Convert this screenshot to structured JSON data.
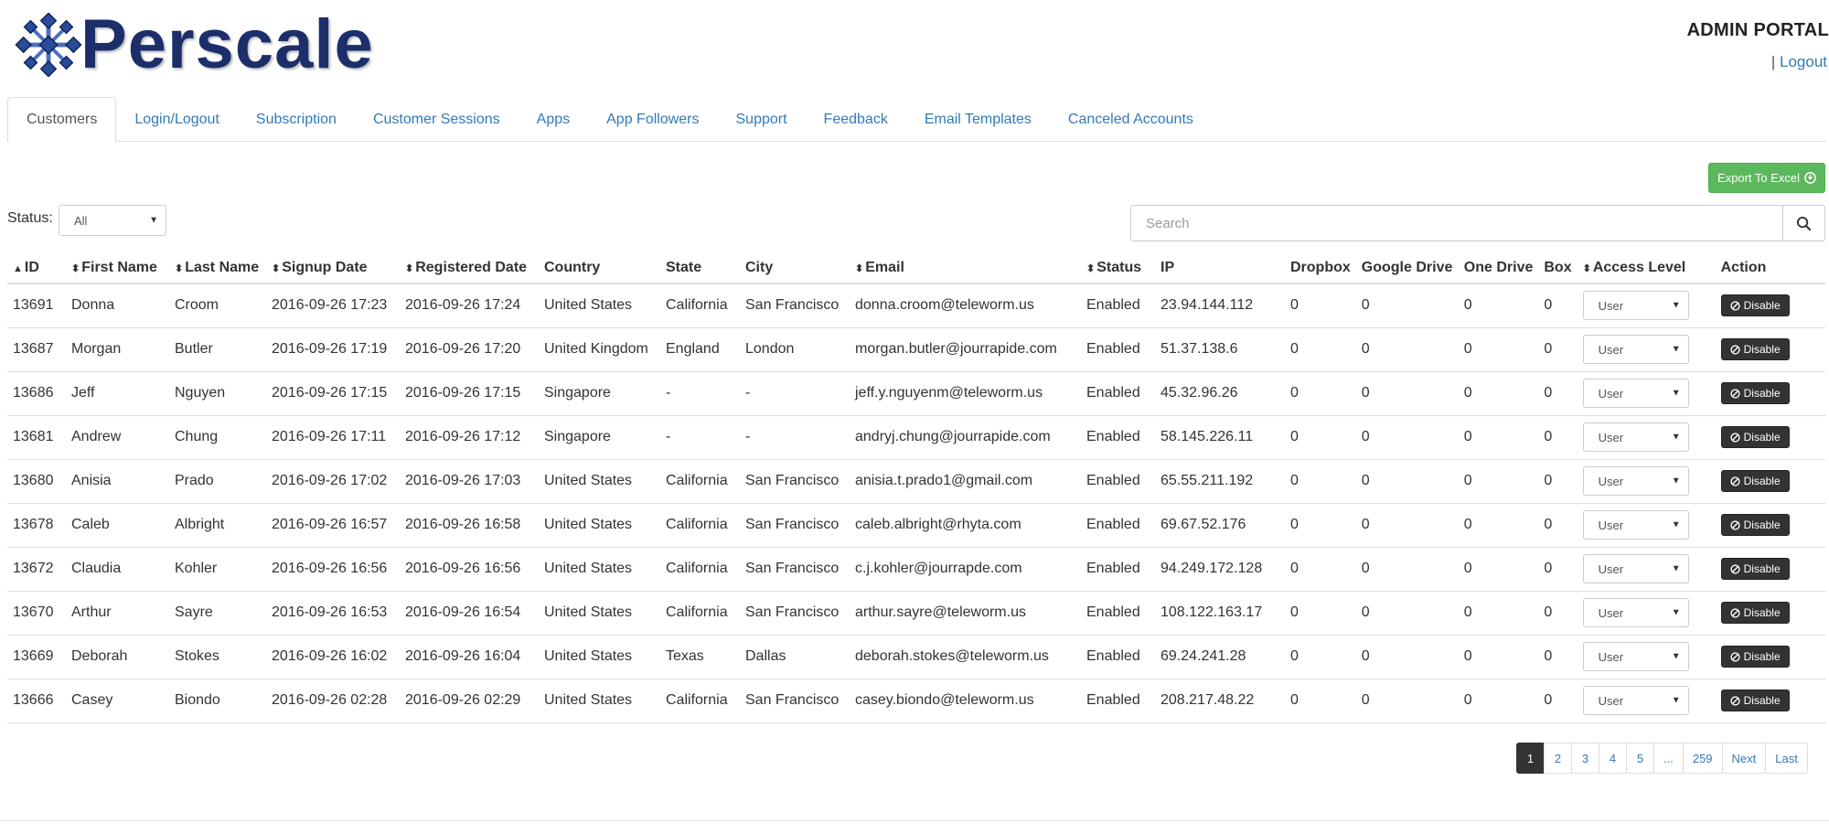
{
  "brand": {
    "name": "Perscale",
    "color": "#1c2f6b"
  },
  "header": {
    "portal_title": "ADMIN PORTAL",
    "separator": "|",
    "logout_label": "Logout"
  },
  "tabs": [
    {
      "label": "Customers",
      "active": true
    },
    {
      "label": "Login/Logout"
    },
    {
      "label": "Subscription"
    },
    {
      "label": "Customer Sessions"
    },
    {
      "label": "Apps"
    },
    {
      "label": "App Followers"
    },
    {
      "label": "Support"
    },
    {
      "label": "Feedback"
    },
    {
      "label": "Email Templates"
    },
    {
      "label": "Canceled Accounts"
    }
  ],
  "toolbar": {
    "export_label": "Export To Excel",
    "status_label": "Status:",
    "status_value": "All",
    "search_placeholder": "Search"
  },
  "table": {
    "columns": [
      "ID",
      "First Name",
      "Last Name",
      "Signup Date",
      "Registered Date",
      "Country",
      "State",
      "City",
      "Email",
      "Status",
      "IP",
      "Dropbox",
      "Google Drive",
      "One Drive",
      "Box",
      "Access Level",
      "Action"
    ],
    "rows": [
      {
        "id": "13691",
        "first": "Donna",
        "last": "Croom",
        "signup": "2016-09-26 17:23",
        "registered": "2016-09-26 17:24",
        "country": "United States",
        "state": "California",
        "city": "San Francisco",
        "email": "donna.croom@teleworm.us",
        "status": "Enabled",
        "ip": "23.94.144.112",
        "dropbox": "0",
        "gdrive": "0",
        "onedrive": "0",
        "box": "0",
        "access": "User",
        "action": "Disable"
      },
      {
        "id": "13687",
        "first": "Morgan",
        "last": "Butler",
        "signup": "2016-09-26 17:19",
        "registered": "2016-09-26 17:20",
        "country": "United Kingdom",
        "state": "England",
        "city": "London",
        "email": "morgan.butler@jourrapide.com",
        "status": "Enabled",
        "ip": "51.37.138.6",
        "dropbox": "0",
        "gdrive": "0",
        "onedrive": "0",
        "box": "0",
        "access": "User",
        "action": "Disable"
      },
      {
        "id": "13686",
        "first": "Jeff",
        "last": "Nguyen",
        "signup": "2016-09-26 17:15",
        "registered": "2016-09-26 17:15",
        "country": "Singapore",
        "state": "-",
        "city": "-",
        "email": "jeff.y.nguyenm@teleworm.us",
        "status": "Enabled",
        "ip": "45.32.96.26",
        "dropbox": "0",
        "gdrive": "0",
        "onedrive": "0",
        "box": "0",
        "access": "User",
        "action": "Disable"
      },
      {
        "id": "13681",
        "first": "Andrew",
        "last": "Chung",
        "signup": "2016-09-26 17:11",
        "registered": "2016-09-26 17:12",
        "country": "Singapore",
        "state": "-",
        "city": "-",
        "email": "andryj.chung@jourrapide.com",
        "status": "Enabled",
        "ip": "58.145.226.11",
        "dropbox": "0",
        "gdrive": "0",
        "onedrive": "0",
        "box": "0",
        "access": "User",
        "action": "Disable"
      },
      {
        "id": "13680",
        "first": "Anisia",
        "last": "Prado",
        "signup": "2016-09-26 17:02",
        "registered": "2016-09-26 17:03",
        "country": "United States",
        "state": "California",
        "city": "San Francisco",
        "email": "anisia.t.prado1@gmail.com",
        "status": "Enabled",
        "ip": "65.55.211.192",
        "dropbox": "0",
        "gdrive": "0",
        "onedrive": "0",
        "box": "0",
        "access": "User",
        "action": "Disable"
      },
      {
        "id": "13678",
        "first": "Caleb",
        "last": "Albright",
        "signup": "2016-09-26 16:57",
        "registered": "2016-09-26 16:58",
        "country": "United States",
        "state": "California",
        "city": "San Francisco",
        "email": "caleb.albright@rhyta.com",
        "status": "Enabled",
        "ip": "69.67.52.176",
        "dropbox": "0",
        "gdrive": "0",
        "onedrive": "0",
        "box": "0",
        "access": "User",
        "action": "Disable"
      },
      {
        "id": "13672",
        "first": "Claudia",
        "last": "Kohler",
        "signup": "2016-09-26 16:56",
        "registered": "2016-09-26 16:56",
        "country": "United States",
        "state": "California",
        "city": "San Francisco",
        "email": "c.j.kohler@jourrapde.com",
        "status": "Enabled",
        "ip": "94.249.172.128",
        "dropbox": "0",
        "gdrive": "0",
        "onedrive": "0",
        "box": "0",
        "access": "User",
        "action": "Disable"
      },
      {
        "id": "13670",
        "first": "Arthur",
        "last": "Sayre",
        "signup": "2016-09-26 16:53",
        "registered": "2016-09-26 16:54",
        "country": "United States",
        "state": "California",
        "city": "San Francisco",
        "email": "arthur.sayre@teleworm.us",
        "status": "Enabled",
        "ip": "108.122.163.17",
        "dropbox": "0",
        "gdrive": "0",
        "onedrive": "0",
        "box": "0",
        "access": "User",
        "action": "Disable"
      },
      {
        "id": "13669",
        "first": "Deborah",
        "last": "Stokes",
        "signup": "2016-09-26 16:02",
        "registered": "2016-09-26 16:04",
        "country": "United States",
        "state": "Texas",
        "city": "Dallas",
        "email": "deborah.stokes@teleworm.us",
        "status": "Enabled",
        "ip": "69.24.241.28",
        "dropbox": "0",
        "gdrive": "0",
        "onedrive": "0",
        "box": "0",
        "access": "User",
        "action": "Disable"
      },
      {
        "id": "13666",
        "first": "Casey",
        "last": "Biondo",
        "signup": "2016-09-26 02:28",
        "registered": "2016-09-26 02:29",
        "country": "United States",
        "state": "California",
        "city": "San Francisco",
        "email": "casey.biondo@teleworm.us",
        "status": "Enabled",
        "ip": "208.217.48.22",
        "dropbox": "0",
        "gdrive": "0",
        "onedrive": "0",
        "box": "0",
        "access": "User",
        "action": "Disable"
      }
    ]
  },
  "pagination": {
    "items": [
      {
        "label": "1",
        "active": true
      },
      {
        "label": "2"
      },
      {
        "label": "3"
      },
      {
        "label": "4"
      },
      {
        "label": "5"
      },
      {
        "label": "..."
      },
      {
        "label": "259"
      },
      {
        "label": "Next"
      },
      {
        "label": "Last"
      }
    ]
  },
  "colors": {
    "link": "#337ab7",
    "export": "#5cb85c",
    "dark_button": "#333333",
    "border": "#dddddd"
  }
}
